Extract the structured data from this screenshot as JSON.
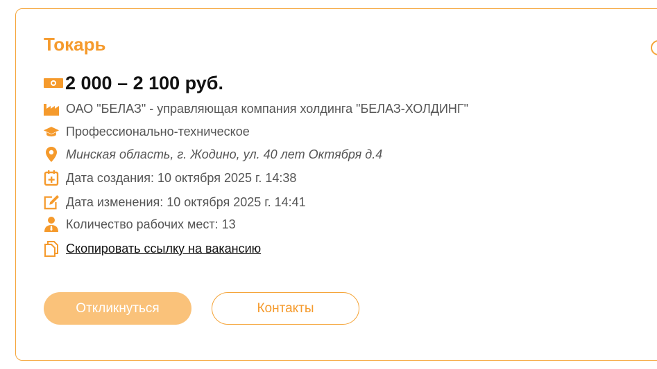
{
  "vacancy": {
    "title": "Токарь",
    "salary": "2 000 – 2 100 руб.",
    "company": "ОАО \"БЕЛАЗ\" - управляющая компания холдинга \"БЕЛАЗ-ХОЛДИНГ\"",
    "education": "Профессионально-техническое",
    "address": "Минская область, г. Жодино, ул. 40 лет Октября д.4",
    "created": "Дата создания: 10 октября 2025 г. 14:38",
    "modified": "Дата изменения: 10 октября 2025 г. 14:41",
    "workplaces": "Количество рабочих мест: 13",
    "copy_link": "Скопировать ссылку на вакансию"
  },
  "actions": {
    "apply_label": "Откликнуться",
    "contacts_label": "Контакты"
  },
  "icons": {
    "salary": "money-icon",
    "company": "factory-icon",
    "education": "graduation-cap-icon",
    "address": "location-pin-icon",
    "created": "calendar-plus-icon",
    "modified": "edit-icon",
    "workplaces": "person-icon",
    "copy_link": "copy-icon"
  },
  "colors": {
    "accent": "#f59a2c",
    "accent_light": "#fac27a",
    "text": "#555555"
  }
}
